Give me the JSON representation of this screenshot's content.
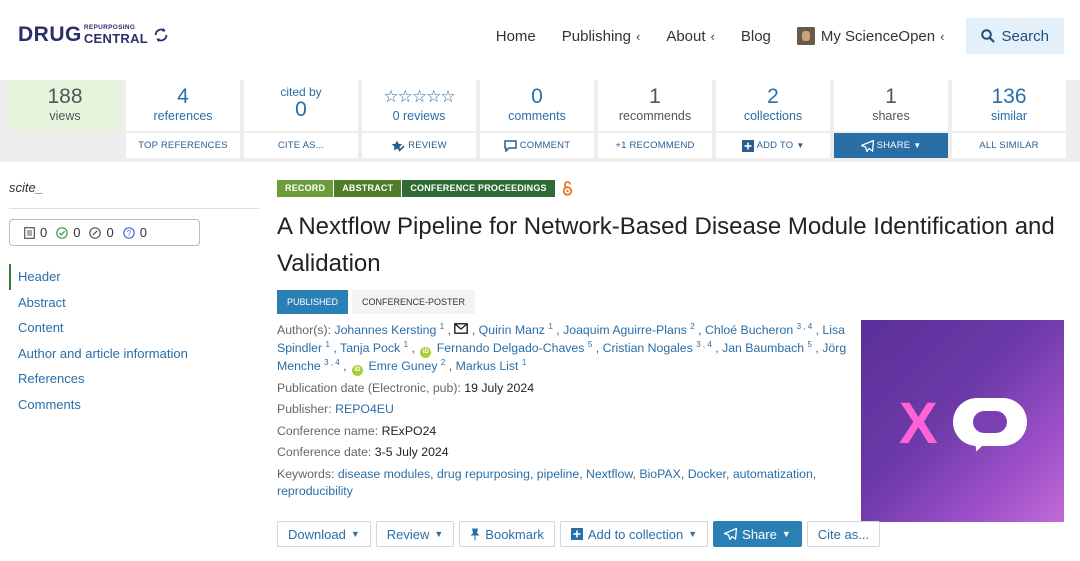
{
  "header": {
    "logo": {
      "main": "DRUG",
      "top": "REPURPOSING",
      "bottom": "CENTRAL"
    },
    "nav": [
      {
        "label": "Home",
        "has_chevron": false
      },
      {
        "label": "Publishing",
        "has_chevron": true
      },
      {
        "label": "About",
        "has_chevron": true
      },
      {
        "label": "Blog",
        "has_chevron": false
      },
      {
        "label": "My ScienceOpen",
        "has_chevron": true
      }
    ],
    "chevron": "‹",
    "search_label": "Search"
  },
  "stats": [
    {
      "num": "188",
      "label": "views",
      "action": ""
    },
    {
      "num": "4",
      "label": "references",
      "action": "TOP REFERENCES"
    },
    {
      "top_label": "cited by",
      "num": "0",
      "action": "CITE AS..."
    },
    {
      "stars": "☆☆☆☆☆",
      "label": "0 reviews",
      "action": "REVIEW"
    },
    {
      "num": "0",
      "label": "comments",
      "action": "COMMENT"
    },
    {
      "num": "1",
      "label": "recommends",
      "action": "+1 RECOMMEND"
    },
    {
      "num": "2",
      "label": "collections",
      "action": "ADD TO"
    },
    {
      "num": "1",
      "label": "shares",
      "action": "SHARE"
    },
    {
      "num": "136",
      "label": "similar",
      "action": "ALL SIMILAR"
    }
  ],
  "sidebar": {
    "scite_label": "scite_",
    "scite_counts": [
      "0",
      "0",
      "0",
      "0"
    ],
    "toc": [
      "Header",
      "Abstract",
      "Content",
      "Author and article information",
      "References",
      "Comments"
    ]
  },
  "article": {
    "badges": [
      "RECORD",
      "ABSTRACT",
      "CONFERENCE PROCEEDINGS"
    ],
    "title": "A Nextflow Pipeline for Network-Based Disease Module Identification and Validation",
    "status": "PUBLISHED",
    "type": "CONFERENCE-POSTER",
    "authors_label": "Author(s):",
    "authors": [
      {
        "name": "Johannes Kersting",
        "aff": "1",
        "mail": true,
        "orcid": false
      },
      {
        "name": "Quirin Manz",
        "aff": "1",
        "mail": false,
        "orcid": false
      },
      {
        "name": "Joaquim Aguirre-Plans",
        "aff": "2",
        "mail": false,
        "orcid": false
      },
      {
        "name": "Chloé Bucheron",
        "aff": "3 , 4",
        "mail": false,
        "orcid": false
      },
      {
        "name": "Lisa Spindler",
        "aff": "1",
        "mail": false,
        "orcid": false
      },
      {
        "name": "Tanja Pock",
        "aff": "1",
        "mail": false,
        "orcid": false
      },
      {
        "name": "Fernando Delgado-Chaves",
        "aff": "5",
        "mail": false,
        "orcid": true
      },
      {
        "name": "Cristian Nogales",
        "aff": "3 , 4",
        "mail": false,
        "orcid": false
      },
      {
        "name": "Jan Baumbach",
        "aff": "5",
        "mail": false,
        "orcid": false
      },
      {
        "name": "Jörg Menche",
        "aff": "3 , 4",
        "mail": false,
        "orcid": false
      },
      {
        "name": "Emre Guney",
        "aff": "2",
        "mail": false,
        "orcid": true
      },
      {
        "name": "Markus List",
        "aff": "1",
        "mail": false,
        "orcid": false
      }
    ],
    "pub_date_label": "Publication date (Electronic, pub):",
    "pub_date": "19 July 2024",
    "publisher_label": "Publisher:",
    "publisher": "REPO4EU",
    "conf_name_label": "Conference name:",
    "conf_name": "RExPO24",
    "conf_date_label": "Conference date:",
    "conf_date": "3-5 July 2024",
    "keywords_label": "Keywords:",
    "keywords": [
      "disease modules",
      "drug repurposing",
      "pipeline",
      "Nextflow",
      "BioPAX",
      "Docker",
      "automatization",
      "reproducibility"
    ],
    "cover_text": "X"
  },
  "actions": [
    {
      "label": "Download",
      "caret": true
    },
    {
      "label": "Review",
      "caret": true
    },
    {
      "label": "Bookmark",
      "caret": false
    },
    {
      "label": "Add to collection",
      "caret": true
    },
    {
      "label": "Share",
      "caret": true
    },
    {
      "label": "Cite as...",
      "caret": false
    }
  ],
  "colors": {
    "accent": "#2a6ea6",
    "badge_green": "#6b9e3a",
    "published_blue": "#2a7fb4",
    "views_bg": "#e6f4de",
    "cover_purple": "#6d3aa8",
    "cover_pink": "#ff63d6"
  }
}
